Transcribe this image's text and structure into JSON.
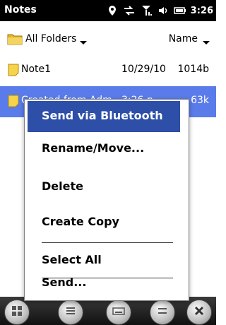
{
  "app": {
    "title": "Notes",
    "clock": "3:26"
  },
  "status_icons": [
    "location-icon",
    "sync-icon",
    "signal-icon",
    "volume-icon",
    "battery-icon"
  ],
  "header": {
    "folder_label": "All Folders",
    "sort_label": "Name"
  },
  "notes": [
    {
      "name": "Note1",
      "date": "10/29/10",
      "size": "1014b"
    },
    {
      "name": "Created from Adm...",
      "date": "3:26 p",
      "size": "63k",
      "selected": true
    }
  ],
  "menu": {
    "items": [
      {
        "label": "Send via Bluetooth",
        "selected": true
      },
      {
        "label": "Rename/Move..."
      },
      {
        "label": "Delete"
      },
      {
        "label": "Create Copy"
      },
      {
        "label": "Select All"
      },
      {
        "label": "Send..."
      }
    ]
  },
  "bottom_buttons": [
    "start-icon",
    "menu-icon",
    "keyboard-icon",
    "menu-icon",
    "close-icon"
  ]
}
